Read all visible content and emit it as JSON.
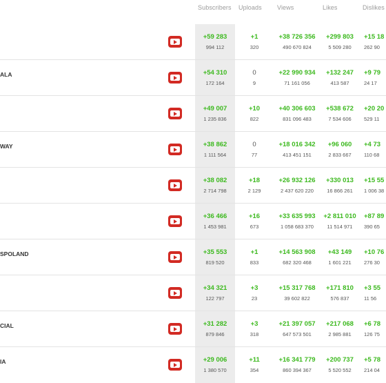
{
  "columns": {
    "subscribers": "Subscribers",
    "uploads": "Uploads",
    "views": "Views",
    "likes": "Likes",
    "dislikes": "Dislikes"
  },
  "colors": {
    "gain": "#3cb91e",
    "youtube": "#d22a23",
    "highlight": "#ececec"
  },
  "rows": [
    {
      "name": "",
      "subs_delta": "+59 283",
      "subs_total": "994 112",
      "up_delta": "+1",
      "up_total": "320",
      "views_delta": "+38 726 356",
      "views_total": "490 670 824",
      "likes_delta": "+299 803",
      "likes_total": "5 509 280",
      "dis_delta": "+15 18",
      "dis_total": "262 90"
    },
    {
      "name": "ALA",
      "subs_delta": "+54 310",
      "subs_total": "172 164",
      "up_delta": "0",
      "up_total": "9",
      "views_delta": "+22 990 934",
      "views_total": "71 161 056",
      "likes_delta": "+132 247",
      "likes_total": "413 587",
      "dis_delta": "+9 79",
      "dis_total": "24 17"
    },
    {
      "name": "",
      "subs_delta": "+49 007",
      "subs_total": "1 235 836",
      "up_delta": "+10",
      "up_total": "822",
      "views_delta": "+40 306 603",
      "views_total": "831 096 483",
      "likes_delta": "+538 672",
      "likes_total": "7 534 606",
      "dis_delta": "+20 20",
      "dis_total": "529 11"
    },
    {
      "name": "WAY",
      "subs_delta": "+38 862",
      "subs_total": "1 111 564",
      "up_delta": "0",
      "up_total": "77",
      "views_delta": "+18 016 342",
      "views_total": "413 451 151",
      "likes_delta": "+96 060",
      "likes_total": "2 833 667",
      "dis_delta": "+4 73",
      "dis_total": "110 68"
    },
    {
      "name": "",
      "subs_delta": "+38 082",
      "subs_total": "2 714 798",
      "up_delta": "+18",
      "up_total": "2 129",
      "views_delta": "+26 932 126",
      "views_total": "2 437 620 220",
      "likes_delta": "+330 013",
      "likes_total": "16 866 261",
      "dis_delta": "+15 55",
      "dis_total": "1 006 38"
    },
    {
      "name": "",
      "subs_delta": "+36 466",
      "subs_total": "1 453 981",
      "up_delta": "+16",
      "up_total": "673",
      "views_delta": "+33 635 993",
      "views_total": "1 058 683 370",
      "likes_delta": "+2 811 010",
      "likes_total": "11 514 971",
      "dis_delta": "+87 89",
      "dis_total": "390 65"
    },
    {
      "name": "SPOLAND",
      "subs_delta": "+35 553",
      "subs_total": "819 520",
      "up_delta": "+1",
      "up_total": "833",
      "views_delta": "+14 563 908",
      "views_total": "682 320 468",
      "likes_delta": "+43 149",
      "likes_total": "1 601 221",
      "dis_delta": "+10 76",
      "dis_total": "276 30"
    },
    {
      "name": "",
      "subs_delta": "+34 321",
      "subs_total": "122 797",
      "up_delta": "+3",
      "up_total": "23",
      "views_delta": "+15 317 768",
      "views_total": "39 602 822",
      "likes_delta": "+171 810",
      "likes_total": "576 837",
      "dis_delta": "+3 55",
      "dis_total": "11 56"
    },
    {
      "name": "CIAL",
      "subs_delta": "+31 282",
      "subs_total": "879 846",
      "up_delta": "+3",
      "up_total": "318",
      "views_delta": "+21 397 057",
      "views_total": "647 573 501",
      "likes_delta": "+217 068",
      "likes_total": "2 985 881",
      "dis_delta": "+6 78",
      "dis_total": "126 75"
    },
    {
      "name": "IA",
      "subs_delta": "+29 006",
      "subs_total": "1 380 570",
      "up_delta": "+11",
      "up_total": "354",
      "views_delta": "+16 341 779",
      "views_total": "860 394 367",
      "likes_delta": "+200 737",
      "likes_total": "5 520 552",
      "dis_delta": "+5 78",
      "dis_total": "214 04"
    }
  ]
}
